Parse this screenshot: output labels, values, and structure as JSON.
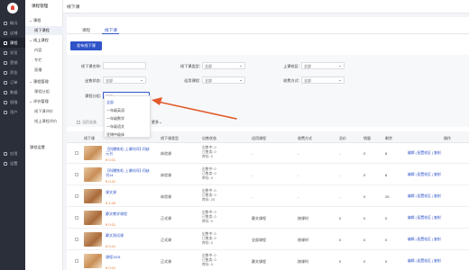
{
  "nav": {
    "items": [
      {
        "label": "概况",
        "icon": "home-icon"
      },
      {
        "label": "店铺",
        "icon": "shop-icon"
      },
      {
        "label": "课程",
        "icon": "course-icon"
      },
      {
        "label": "学员",
        "icon": "student-icon"
      },
      {
        "label": "营销",
        "icon": "marketing-icon"
      },
      {
        "label": "资金",
        "icon": "wallet-icon"
      },
      {
        "label": "订单",
        "icon": "order-icon"
      },
      {
        "label": "数据",
        "icon": "chart-icon"
      },
      {
        "label": "权限",
        "icon": "lock-icon"
      },
      {
        "label": "用户",
        "icon": "user-icon"
      }
    ],
    "bottom": [
      {
        "label": "应用",
        "icon": "apps-icon"
      },
      {
        "label": "设置",
        "icon": "gear-icon"
      }
    ]
  },
  "submenu": {
    "title": "课程管理",
    "items": [
      {
        "label": "课程",
        "type": "group"
      },
      {
        "label": "线下课程",
        "type": "item",
        "active": true
      },
      {
        "label": "线上课程",
        "type": "group"
      },
      {
        "label": "内容",
        "type": "item"
      },
      {
        "label": "专栏",
        "type": "item"
      },
      {
        "label": "直播",
        "type": "item"
      },
      {
        "label": "课程管理",
        "type": "group"
      },
      {
        "label": "课程分组",
        "type": "item"
      },
      {
        "label": "评价管理",
        "type": "group"
      },
      {
        "label": "线下课评价",
        "type": "item"
      },
      {
        "label": "线上课程评价",
        "type": "item"
      },
      {
        "label": "课程设置",
        "type": "group"
      }
    ]
  },
  "header": {
    "title": "线下课"
  },
  "tabs": [
    {
      "label": "课程",
      "active": false
    },
    {
      "label": "线下课",
      "active": true
    }
  ],
  "add_button": "发布线下课",
  "filters": {
    "course_name": {
      "label": "线下课名称:",
      "value": ""
    },
    "course_type": {
      "label": "线下课类型:",
      "value": "全部"
    },
    "campus": {
      "label": "上课校区:",
      "value": "全部"
    },
    "sale_status": {
      "label": "出售状态:",
      "value": "全部"
    },
    "applicable": {
      "label": "适用课程:",
      "value": "全部"
    },
    "charge_mode": {
      "label": "收费方式:",
      "value": "全部"
    },
    "course_group": {
      "label": "课程分组:",
      "placeholder": "全部"
    }
  },
  "dropdown": {
    "options": [
      "全部",
      "一年级英语",
      "一年级数学",
      "一年级语文",
      "亚博中级体"
    ]
  },
  "toolbar": {
    "select_all": "当页全选",
    "more": "更多"
  },
  "table": {
    "columns": [
      "线下课",
      "线下课类型",
      "出售状态",
      "适用课程",
      "收费方式",
      "总价",
      "销量",
      "剩余",
      "操作"
    ],
    "rows": [
      {
        "name": "【科爆铁毛-上课时间】·问缺元刊",
        "price": "¥ 0.01",
        "type": "体验课",
        "status": "出售中: 0",
        "sold": "已售卖: 0",
        "remain": "库存: 0",
        "applicable": "-",
        "charge": "-",
        "total": "-",
        "sales": "0",
        "left": "8",
        "ops": "编辑 | 配置校区 | 复制",
        "thumb": "a"
      },
      {
        "name": "【科爆铁毛-上课时间】·问缺刊14",
        "price": "¥ 0.01",
        "type": "体验课",
        "status": "出售中: 0",
        "sold": "已售卖: 0",
        "remain": "库存: 0",
        "applicable": "-",
        "charge": "-",
        "total": "-",
        "sales": "0",
        "left": "8",
        "ops": "编辑 | 配置校区 | 复制",
        "thumb": "a"
      },
      {
        "name": "课文课",
        "price": "¥ 1.00",
        "type": "体验课",
        "status": "出售中: 0",
        "sold": "已售卖: 0",
        "remain": "库存: 25",
        "applicable": "-",
        "charge": "-",
        "total": "-",
        "sales": "0",
        "left": "25",
        "ops": "编辑 | 配置校区 | 复制",
        "thumb": "b"
      },
      {
        "name": "静文教学课程",
        "price": "¥ 0.01",
        "type": "正式课",
        "status": "出售中: 0",
        "sold": "已售卖: 0",
        "remain": "库存: 0",
        "applicable": "静文课程",
        "charge": "按课时",
        "total": "0",
        "sales": "0",
        "left": "0",
        "ops": "编辑 | 配置校区 | 复制",
        "thumb": "b"
      },
      {
        "name": "静文测试课",
        "price": "¥ 0.01",
        "type": "正式课",
        "status": "出售中: 0",
        "sold": "已售卖: 0",
        "remain": "库存: 0",
        "applicable": "全部课程",
        "charge": "按课时",
        "total": "0",
        "sales": "0",
        "left": "0",
        "ops": "编辑 | 配置校区 | 复制",
        "thumb": "b"
      },
      {
        "name": "课程1001",
        "price": "¥ 0.01",
        "type": "正式课",
        "status": "出售中: 0",
        "sold": "已售卖: 0",
        "remain": "库存: 0",
        "applicable": "静文课程",
        "charge": "按课时",
        "total": "0",
        "sales": "0",
        "left": "0",
        "ops": "编辑 | 配置校区 | 复制",
        "thumb": "a"
      }
    ]
  },
  "colors": {
    "primary": "#2f54c9",
    "price": "#e8772e",
    "arrow": "#e25a2b",
    "sidebar": "#2b2f3a"
  }
}
